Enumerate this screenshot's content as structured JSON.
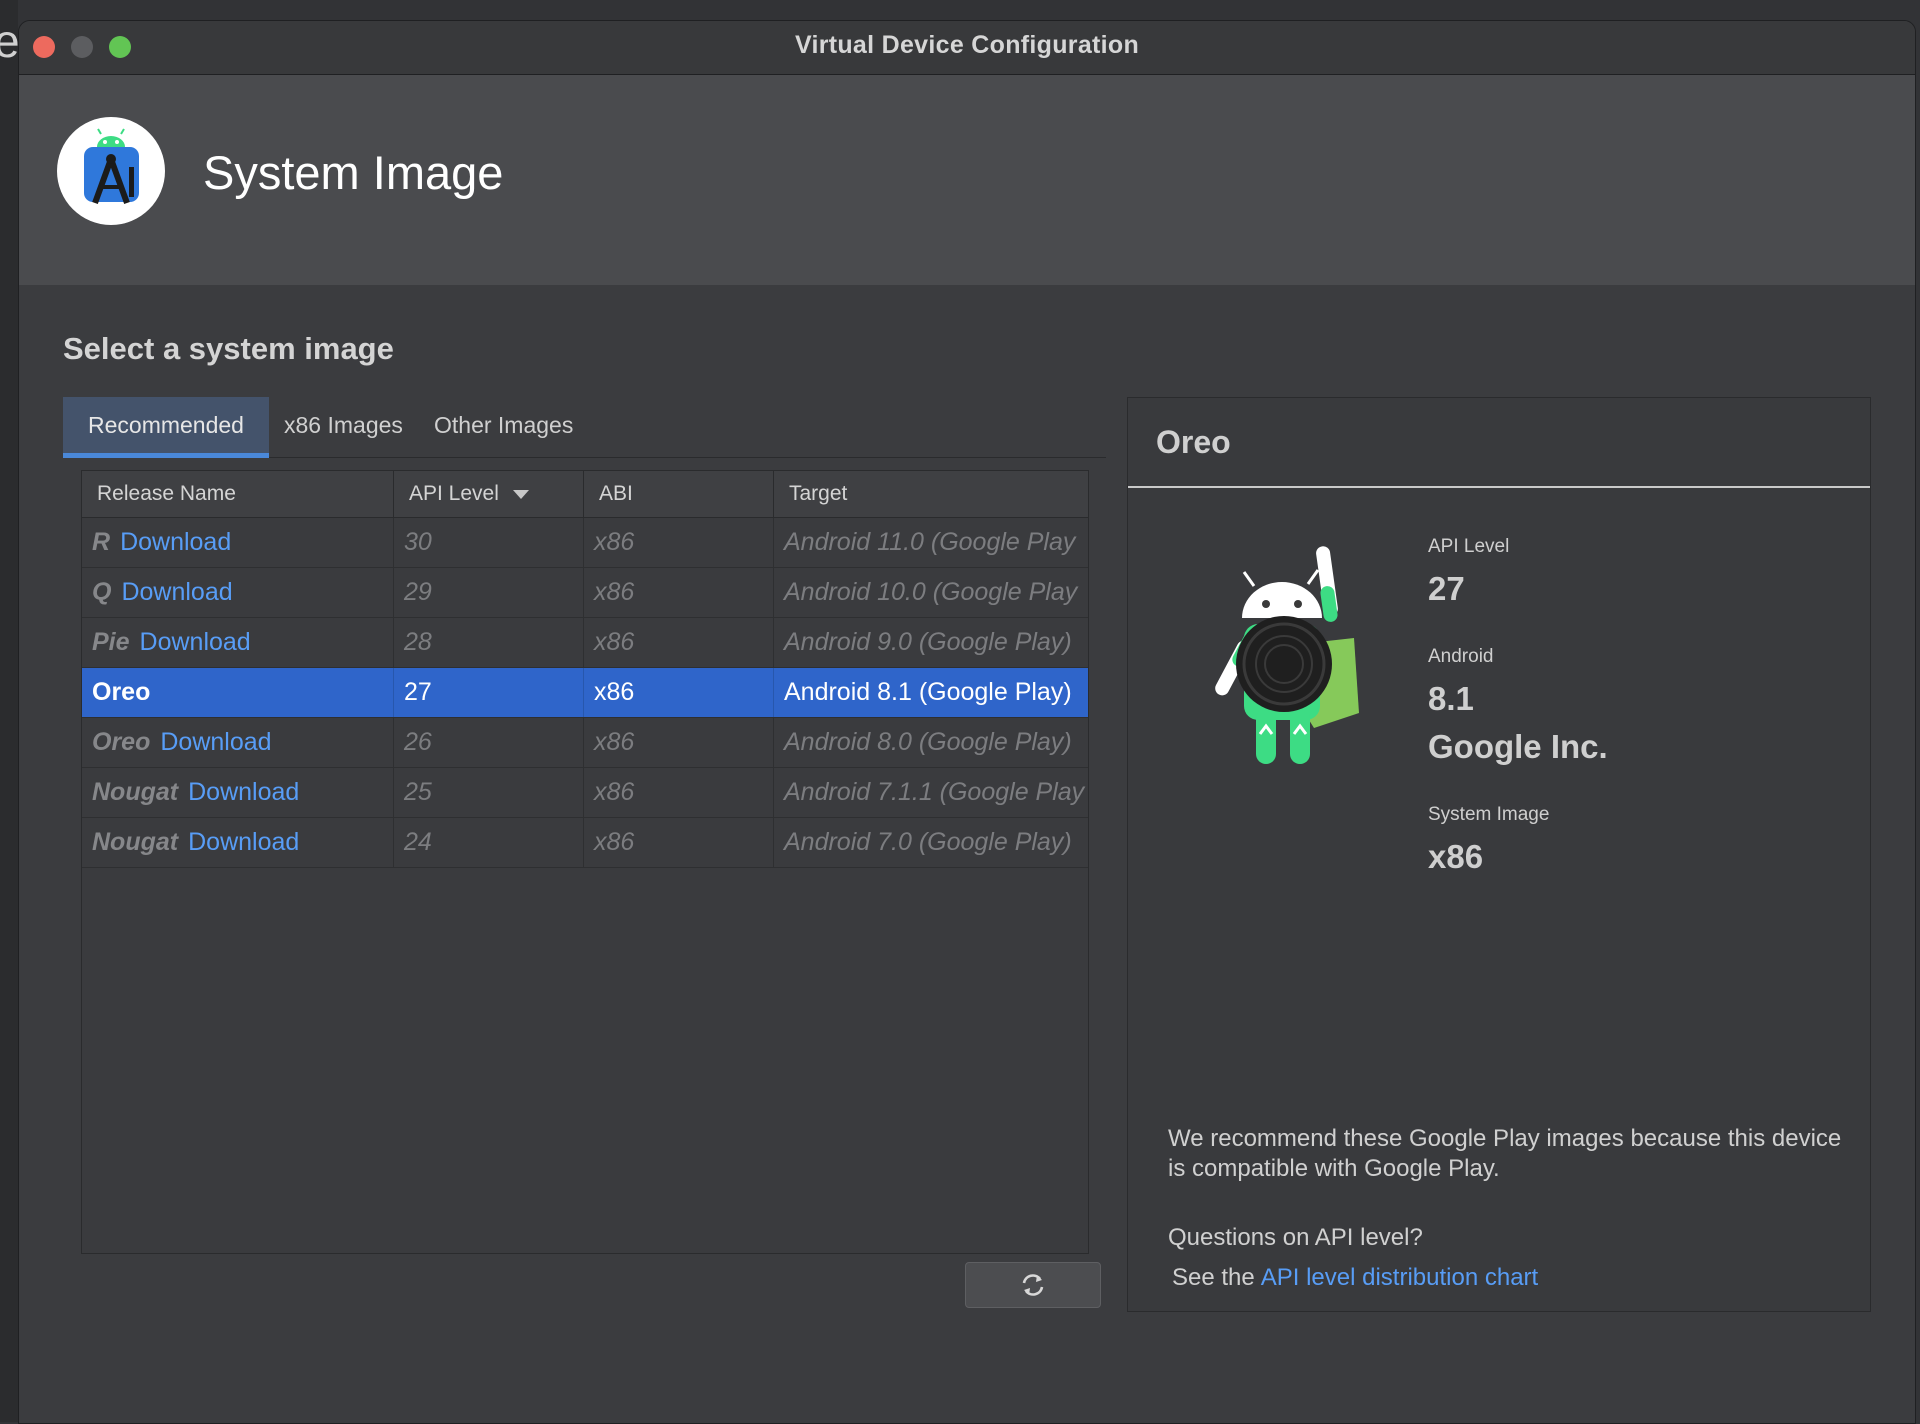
{
  "window": {
    "title": "Virtual Device Configuration"
  },
  "header": {
    "title": "System Image",
    "logo": "android-studio-logo"
  },
  "section": {
    "title": "Select a system image"
  },
  "tabs": [
    {
      "label": "Recommended",
      "active": true
    },
    {
      "label": "x86 Images",
      "active": false
    },
    {
      "label": "Other Images",
      "active": false
    }
  ],
  "table": {
    "columns": [
      "Release Name",
      "API Level",
      "ABI",
      "Target"
    ],
    "sort_column": "API Level",
    "rows": [
      {
        "name": "R",
        "download": "Download",
        "api": "30",
        "abi": "x86",
        "target": "Android 11.0 (Google Play",
        "selected": false
      },
      {
        "name": "Q",
        "download": "Download",
        "api": "29",
        "abi": "x86",
        "target": "Android 10.0 (Google Play",
        "selected": false
      },
      {
        "name": "Pie",
        "download": "Download",
        "api": "28",
        "abi": "x86",
        "target": "Android 9.0 (Google Play)",
        "selected": false
      },
      {
        "name": "Oreo",
        "download": "",
        "api": "27",
        "abi": "x86",
        "target": "Android 8.1 (Google Play)",
        "selected": true
      },
      {
        "name": "Oreo",
        "download": "Download",
        "api": "26",
        "abi": "x86",
        "target": "Android 8.0 (Google Play)",
        "selected": false
      },
      {
        "name": "Nougat",
        "download": "Download",
        "api": "25",
        "abi": "x86",
        "target": "Android 7.1.1 (Google Play",
        "selected": false
      },
      {
        "name": "Nougat",
        "download": "Download",
        "api": "24",
        "abi": "x86",
        "target": "Android 7.0 (Google Play)",
        "selected": false
      }
    ]
  },
  "refresh_button": {
    "icon": "refresh-icon"
  },
  "detail": {
    "title": "Oreo",
    "image": "android-oreo-mascot",
    "api_level_label": "API Level",
    "api_level_value": "27",
    "android_label": "Android",
    "android_version": "8.1",
    "vendor": "Google Inc.",
    "system_image_label": "System Image",
    "system_image_value": "x86",
    "note": "We recommend these Google Play images because this device is compatible with Google Play.",
    "question": "Questions on API level?",
    "see_prefix": "See the",
    "chart_link": "API level distribution chart"
  },
  "colors": {
    "accent": "#2f65ca",
    "link": "#589df6",
    "tab_active": "#44536b",
    "tab_underline": "#4a88d9"
  }
}
